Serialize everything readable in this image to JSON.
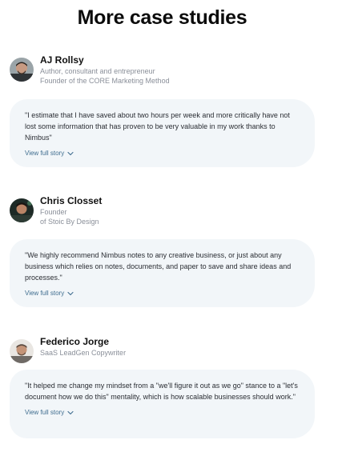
{
  "page": {
    "title": "More case studies"
  },
  "cases": [
    {
      "name": "AJ Rollsy",
      "roles": [
        "Author, consultant and entrepreneur",
        "Founder of the CORE Marketing Method"
      ],
      "quote": "\"I estimate that I have saved about two hours per week and more critically have not lost some information that has proven to be very valuable in my work thanks to Nimbus\"",
      "link_label": "View full story",
      "avatar_icon": "avatar-photo-icon"
    },
    {
      "name": "Chris Closset",
      "roles": [
        "Founder",
        "of Stoic By Design"
      ],
      "quote": "\"We highly recommend Nimbus notes to any creative business, or just about any business which relies on notes, documents, and paper to save and share ideas and processes.\"",
      "link_label": "View full story",
      "avatar_icon": "avatar-photo-icon"
    },
    {
      "name": "Federico Jorge",
      "roles": [
        "SaaS LeadGen Copywriter"
      ],
      "quote": "\"It helped me change my mindset from a \"we'll figure it out as we go\" stance to a \"let's document how we do this\" mentality, which is how scalable businesses should work.\"",
      "link_label": "View full story",
      "avatar_icon": "avatar-photo-icon"
    }
  ],
  "colors": {
    "card_background": "#f2f6f9",
    "link": "#3f6d8f",
    "muted_text": "#8a8f99",
    "title": "#0b0b0b"
  },
  "icons": {
    "expand": "chevron-down-icon"
  }
}
